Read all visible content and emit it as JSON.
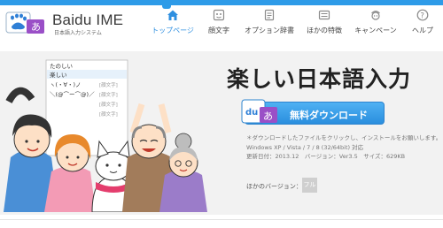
{
  "logo": {
    "brand": "Baidu IME",
    "subtitle": "日本語入力システム",
    "mark_text": "あ"
  },
  "nav": {
    "items": [
      {
        "label": "トップページ",
        "icon": "home-icon",
        "active": true
      },
      {
        "label": "顔文字",
        "icon": "kaomoji-icon",
        "active": false
      },
      {
        "label": "オプション辞書",
        "icon": "dictionary-icon",
        "active": false
      },
      {
        "label": "ほかの特徴",
        "icon": "features-icon",
        "active": false
      },
      {
        "label": "キャンペーン",
        "icon": "campaign-icon",
        "active": false
      },
      {
        "label": "ヘルプ",
        "icon": "help-icon",
        "active": false
      }
    ]
  },
  "hero": {
    "headline": "楽しい日本語入力",
    "download_label": "無料ダウンロード",
    "note": "＊ダウンロードしたファイルをクリックし、インストールをお願いします。",
    "os": "Windows XP / Vista / 7 / 8 (32/64bit) 対応",
    "updated": "更新日付：2013.12　バージョン：Ver3.5　サイズ：629KB",
    "other_versions_label": "ほかのバージョン：",
    "other_badge": "フル"
  },
  "illustration": {
    "bubble_lines": [
      "たのしい",
      "楽しい",
      "ヽ(・∀・)ノ",
      "＼(@⌒ー⌒@)／"
    ],
    "candidate_lines": [
      "[顔文字]",
      "[顔文字]",
      "[顔文字]",
      "[顔文字]"
    ]
  },
  "colors": {
    "accent": "#2e9be8",
    "button": "#3a9ee8",
    "hero_bg": "#f2f2f2"
  }
}
